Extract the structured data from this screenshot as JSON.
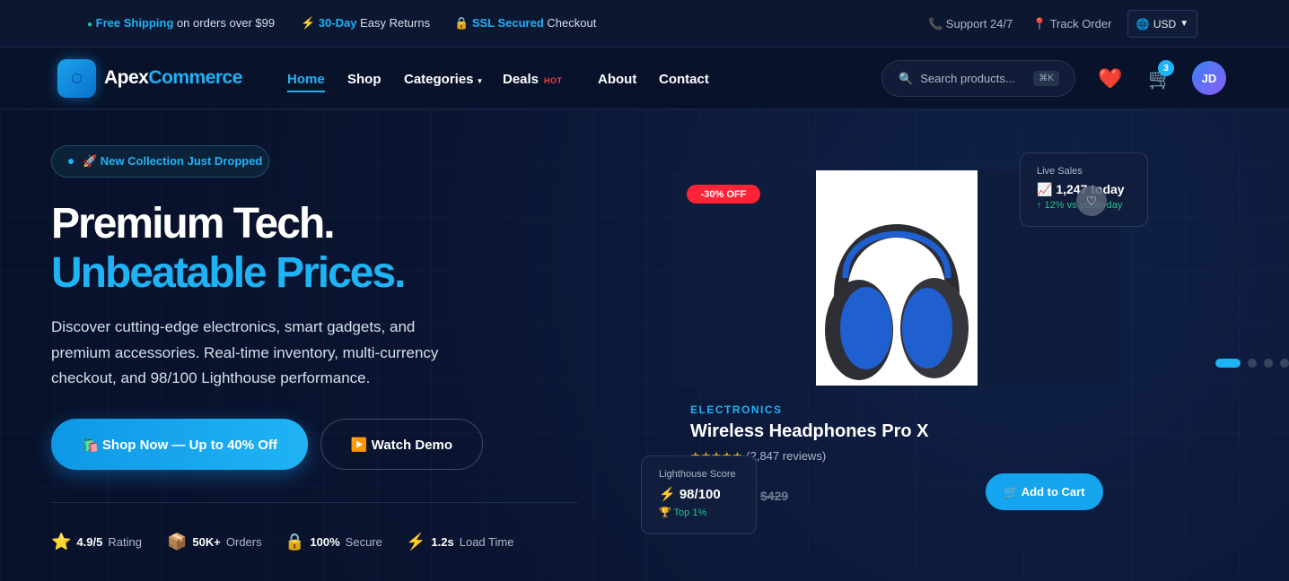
{
  "topbar": {
    "shipping": {
      "highlight": "Free Shipping",
      "text": " on orders over $99"
    },
    "returns": {
      "icon": "⚡",
      "highlight": "30-Day",
      "text": " Easy Returns"
    },
    "secure": {
      "icon": "🔒",
      "highlight": "SSL Secured",
      "text": " Checkout"
    },
    "support": "📞 Support 24/7",
    "track": "📍 Track Order",
    "currency": "USD"
  },
  "nav": {
    "logo_a": "Apex",
    "logo_b": "Commerce",
    "links": [
      "Home",
      "Shop",
      "Categories",
      "Deals",
      "About",
      "Contact"
    ],
    "hot": "HOT",
    "search_placeholder": "Search products...",
    "search_kbd": "⌘K",
    "cart_count": "3",
    "avatar": "JD"
  },
  "hero": {
    "pill": "🚀 New Collection Just Dropped",
    "title_1": "Premium Tech.",
    "title_2": "Unbeatable Prices.",
    "description": "Discover cutting-edge electronics, smart gadgets, and premium accessories. Real-time inventory, multi-currency checkout, and 98/100 Lighthouse performance.",
    "primary_cta": "🛍️ Shop Now — Up to 40% Off",
    "secondary_cta": "▶️ Watch Demo",
    "stats": [
      {
        "icon": "⭐",
        "value": "4.9/5",
        "label": "Rating"
      },
      {
        "icon": "📦",
        "value": "50K+",
        "label": "Orders"
      },
      {
        "icon": "🔒",
        "value": "100%",
        "label": "Secure"
      },
      {
        "icon": "⚡",
        "value": "1.2s",
        "label": "Load Time"
      }
    ]
  },
  "product": {
    "discount": "-30% OFF",
    "category": "ELECTRONICS",
    "name": "Wireless Headphones Pro X",
    "stars": "★★★★★",
    "reviews": "(2,847 reviews)",
    "old_price": "$429",
    "add_to_cart": "🛒 Add to Cart"
  },
  "live_sales": {
    "title": "Live Sales",
    "value": "📈 1,247 today",
    "sub": "↑ 12% vs yesterday"
  },
  "lighthouse": {
    "title": "Lighthouse Score",
    "value": "⚡ 98/100",
    "sub": "🏆 Top 1%"
  },
  "colors": {
    "accent": "#1fb3f5",
    "background": "#0b1530",
    "danger": "#ff2336",
    "success": "#22c38e"
  }
}
